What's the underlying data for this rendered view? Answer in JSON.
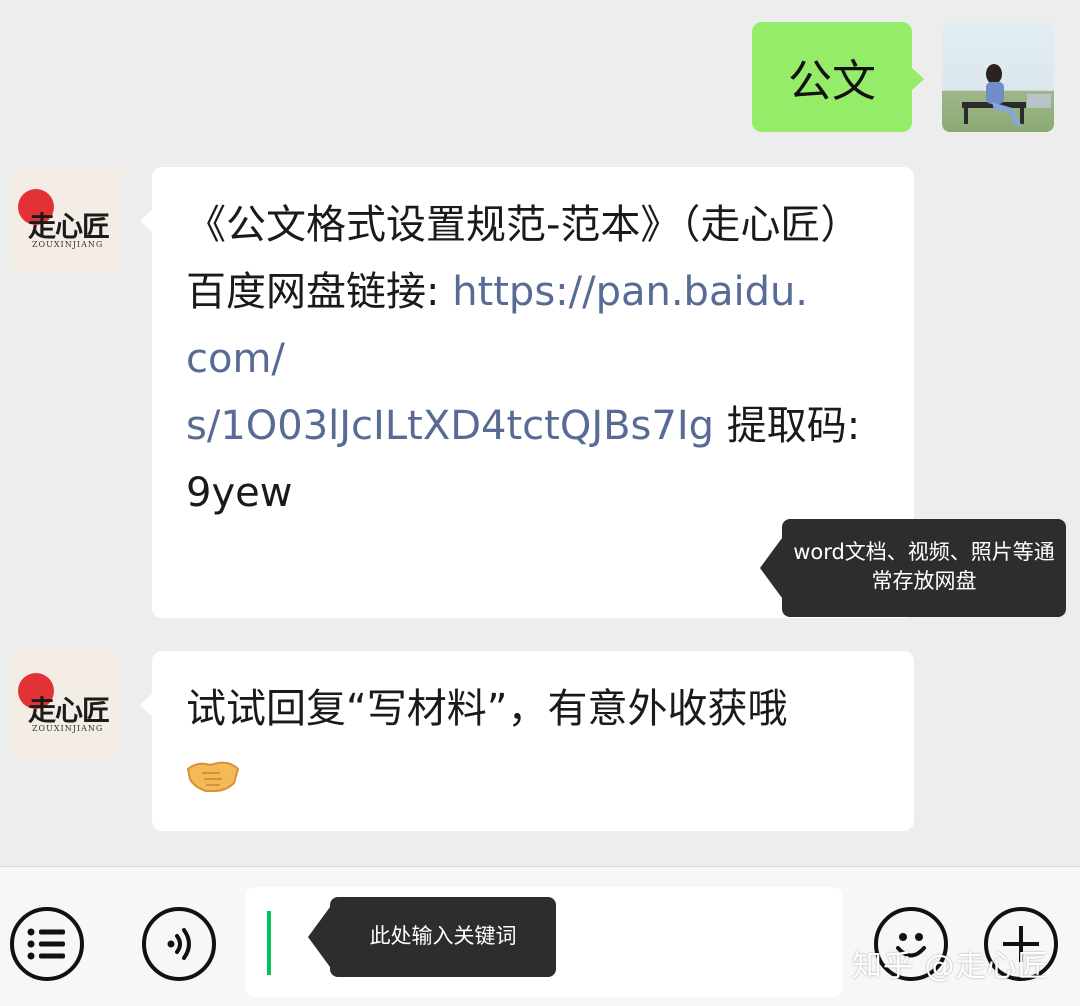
{
  "messages": {
    "outgoing_text": "公文",
    "msg1": {
      "title": "《公文格式设置规范-范本》（走心匠）",
      "link_label": "百度网盘链接: ",
      "link": "https://pan.baidu.com/s/1O03lJcILtXD4tctQJBs7Ig",
      "code_label": " 提取码: ",
      "code": "9yew"
    },
    "msg2": {
      "text": "试试回复“写材料”，有意外收获哦"
    }
  },
  "bot": {
    "brand": "走心匠",
    "brand_sub": "ZOUXINJIANG"
  },
  "tooltips": {
    "doc": "word文档、视频、照片等通常存放网盘",
    "input": "此处输入关键词"
  },
  "watermark": "知乎 @走心匠",
  "icons": {
    "menu": "menu-list-icon",
    "voice": "voice-icon",
    "emoji": "emoji-icon",
    "plus": "plus-icon",
    "handshake": "handshake-emoji"
  },
  "colors": {
    "outgoing_bubble": "#95ec69",
    "link": "#576b95",
    "caret": "#07c160",
    "tooltip": "#2d2d2d"
  }
}
